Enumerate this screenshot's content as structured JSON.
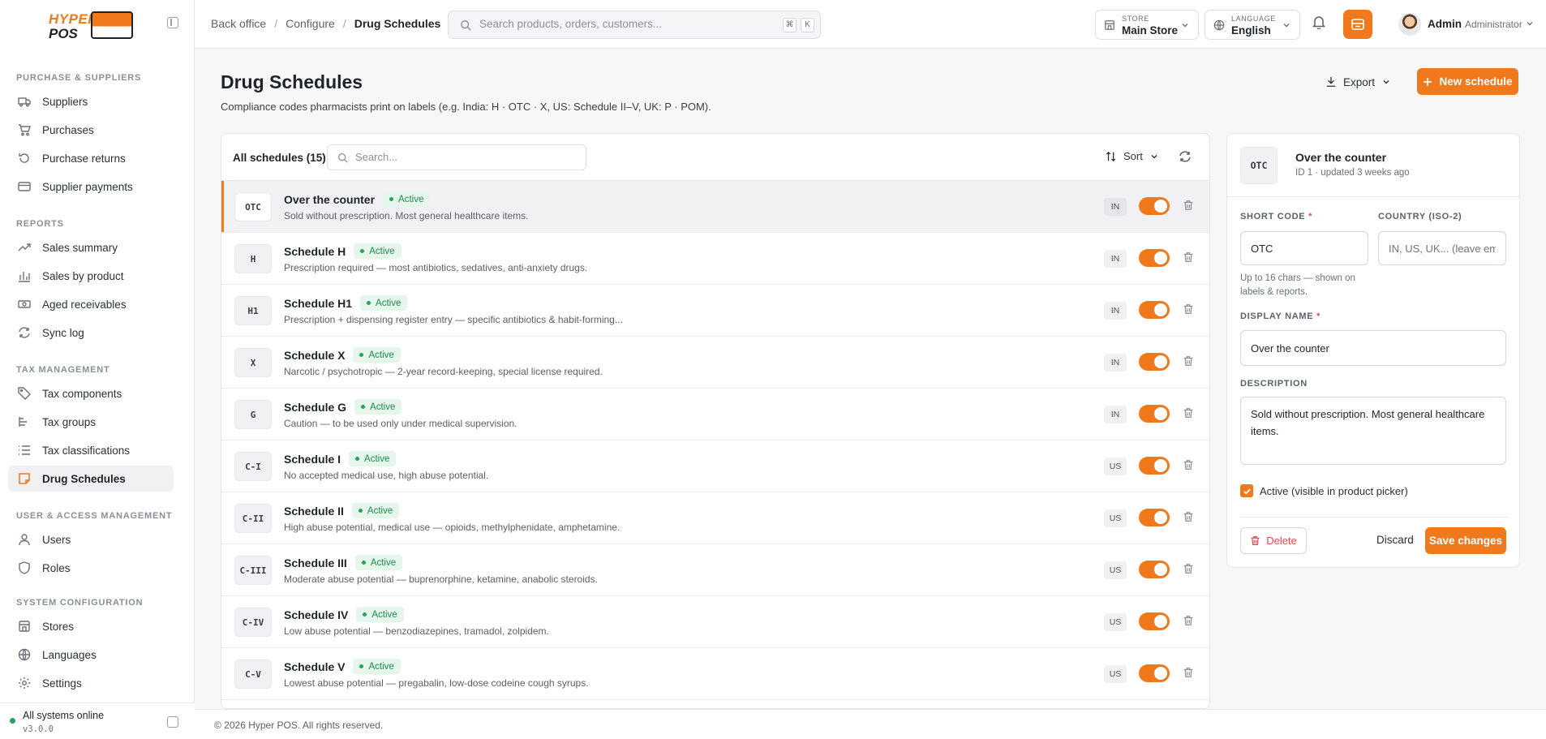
{
  "brand": {
    "line1": "HYPER",
    "line2": "POS"
  },
  "sidebar": {
    "sections": [
      {
        "title": "PURCHASE & SUPPLIERS",
        "items": [
          "Suppliers",
          "Purchases",
          "Purchase returns",
          "Supplier payments"
        ]
      },
      {
        "title": "REPORTS",
        "items": [
          "Sales summary",
          "Sales by product",
          "Aged receivables",
          "Sync log"
        ]
      },
      {
        "title": "TAX MANAGEMENT",
        "items": [
          "Tax components",
          "Tax groups",
          "Tax classifications",
          "Drug Schedules"
        ]
      },
      {
        "title": "USER & ACCESS MANAGEMENT",
        "items": [
          "Users",
          "Roles"
        ]
      },
      {
        "title": "SYSTEM CONFIGURATION",
        "items": [
          "Stores",
          "Languages",
          "Settings"
        ]
      }
    ],
    "active_item": "Drug Schedules",
    "status": {
      "text": "All systems online",
      "version": "v3.0.0"
    }
  },
  "topbar": {
    "breadcrumbs": [
      "Back office",
      "Configure",
      "Drug Schedules"
    ],
    "search_placeholder": "Search products, orders, customers...",
    "shortcut_keys": [
      "⌘",
      "K"
    ],
    "store": {
      "label": "STORE",
      "value": "Main Store"
    },
    "language": {
      "label": "LANGUAGE",
      "value": "English"
    },
    "user": {
      "name": "Admin",
      "role": "Administrator"
    }
  },
  "page": {
    "title": "Drug Schedules",
    "subtitle": "Compliance codes pharmacists print on labels (e.g. India: H · OTC · X, US: Schedule II–V, UK: P · POM).",
    "export_label": "Export",
    "new_label": "New schedule"
  },
  "list": {
    "count_label": "All schedules (15)",
    "search_placeholder": "Search...",
    "sort_label": "Sort",
    "status_label": "Active",
    "rows": [
      {
        "code": "OTC",
        "name": "Over the counter",
        "desc": "Sold without prescription. Most general healthcare items.",
        "country": "IN",
        "selected": true
      },
      {
        "code": "H",
        "name": "Schedule H",
        "desc": "Prescription required — most antibiotics, sedatives, anti-anxiety drugs.",
        "country": "IN"
      },
      {
        "code": "H1",
        "name": "Schedule H1",
        "desc": "Prescription + dispensing register entry — specific antibiotics & habit-forming...",
        "country": "IN"
      },
      {
        "code": "X",
        "name": "Schedule X",
        "desc": "Narcotic / psychotropic — 2-year record-keeping, special license required.",
        "country": "IN"
      },
      {
        "code": "G",
        "name": "Schedule G",
        "desc": "Caution — to be used only under medical supervision.",
        "country": "IN"
      },
      {
        "code": "C-I",
        "name": "Schedule I",
        "desc": "No accepted medical use, high abuse potential.",
        "country": "US"
      },
      {
        "code": "C-II",
        "name": "Schedule II",
        "desc": "High abuse potential, medical use — opioids, methylphenidate, amphetamine.",
        "country": "US"
      },
      {
        "code": "C-III",
        "name": "Schedule III",
        "desc": "Moderate abuse potential — buprenorphine, ketamine, anabolic steroids.",
        "country": "US"
      },
      {
        "code": "C-IV",
        "name": "Schedule IV",
        "desc": "Low abuse potential — benzodiazepines, tramadol, zolpidem.",
        "country": "US"
      },
      {
        "code": "C-V",
        "name": "Schedule V",
        "desc": "Lowest abuse potential — pregabalin, low-dose codeine cough syrups.",
        "country": "US"
      }
    ]
  },
  "detail": {
    "code": "OTC",
    "title": "Over the counter",
    "meta": "ID 1 · updated 3 weeks ago",
    "short_code_label": "SHORT CODE",
    "short_code_value": "OTC",
    "short_code_help": "Up to 16 chars — shown on labels & reports.",
    "country_label": "COUNTRY (ISO-2)",
    "country_placeholder": "IN, US, UK... (leave empty)",
    "display_name_label": "DISPLAY NAME",
    "display_name_value": "Over the counter",
    "description_label": "DESCRIPTION",
    "description_value": "Sold without prescription. Most general healthcare items.",
    "active_label": "Active (visible in product picker)",
    "required_mark": "*",
    "delete_label": "Delete",
    "discard_label": "Discard",
    "save_label": "Save changes"
  },
  "footer": {
    "text": "© 2026 Hyper POS. All rights reserved."
  },
  "colors": {
    "accent": "#f07a1b",
    "success": "#22a559",
    "danger": "#e5484d"
  }
}
